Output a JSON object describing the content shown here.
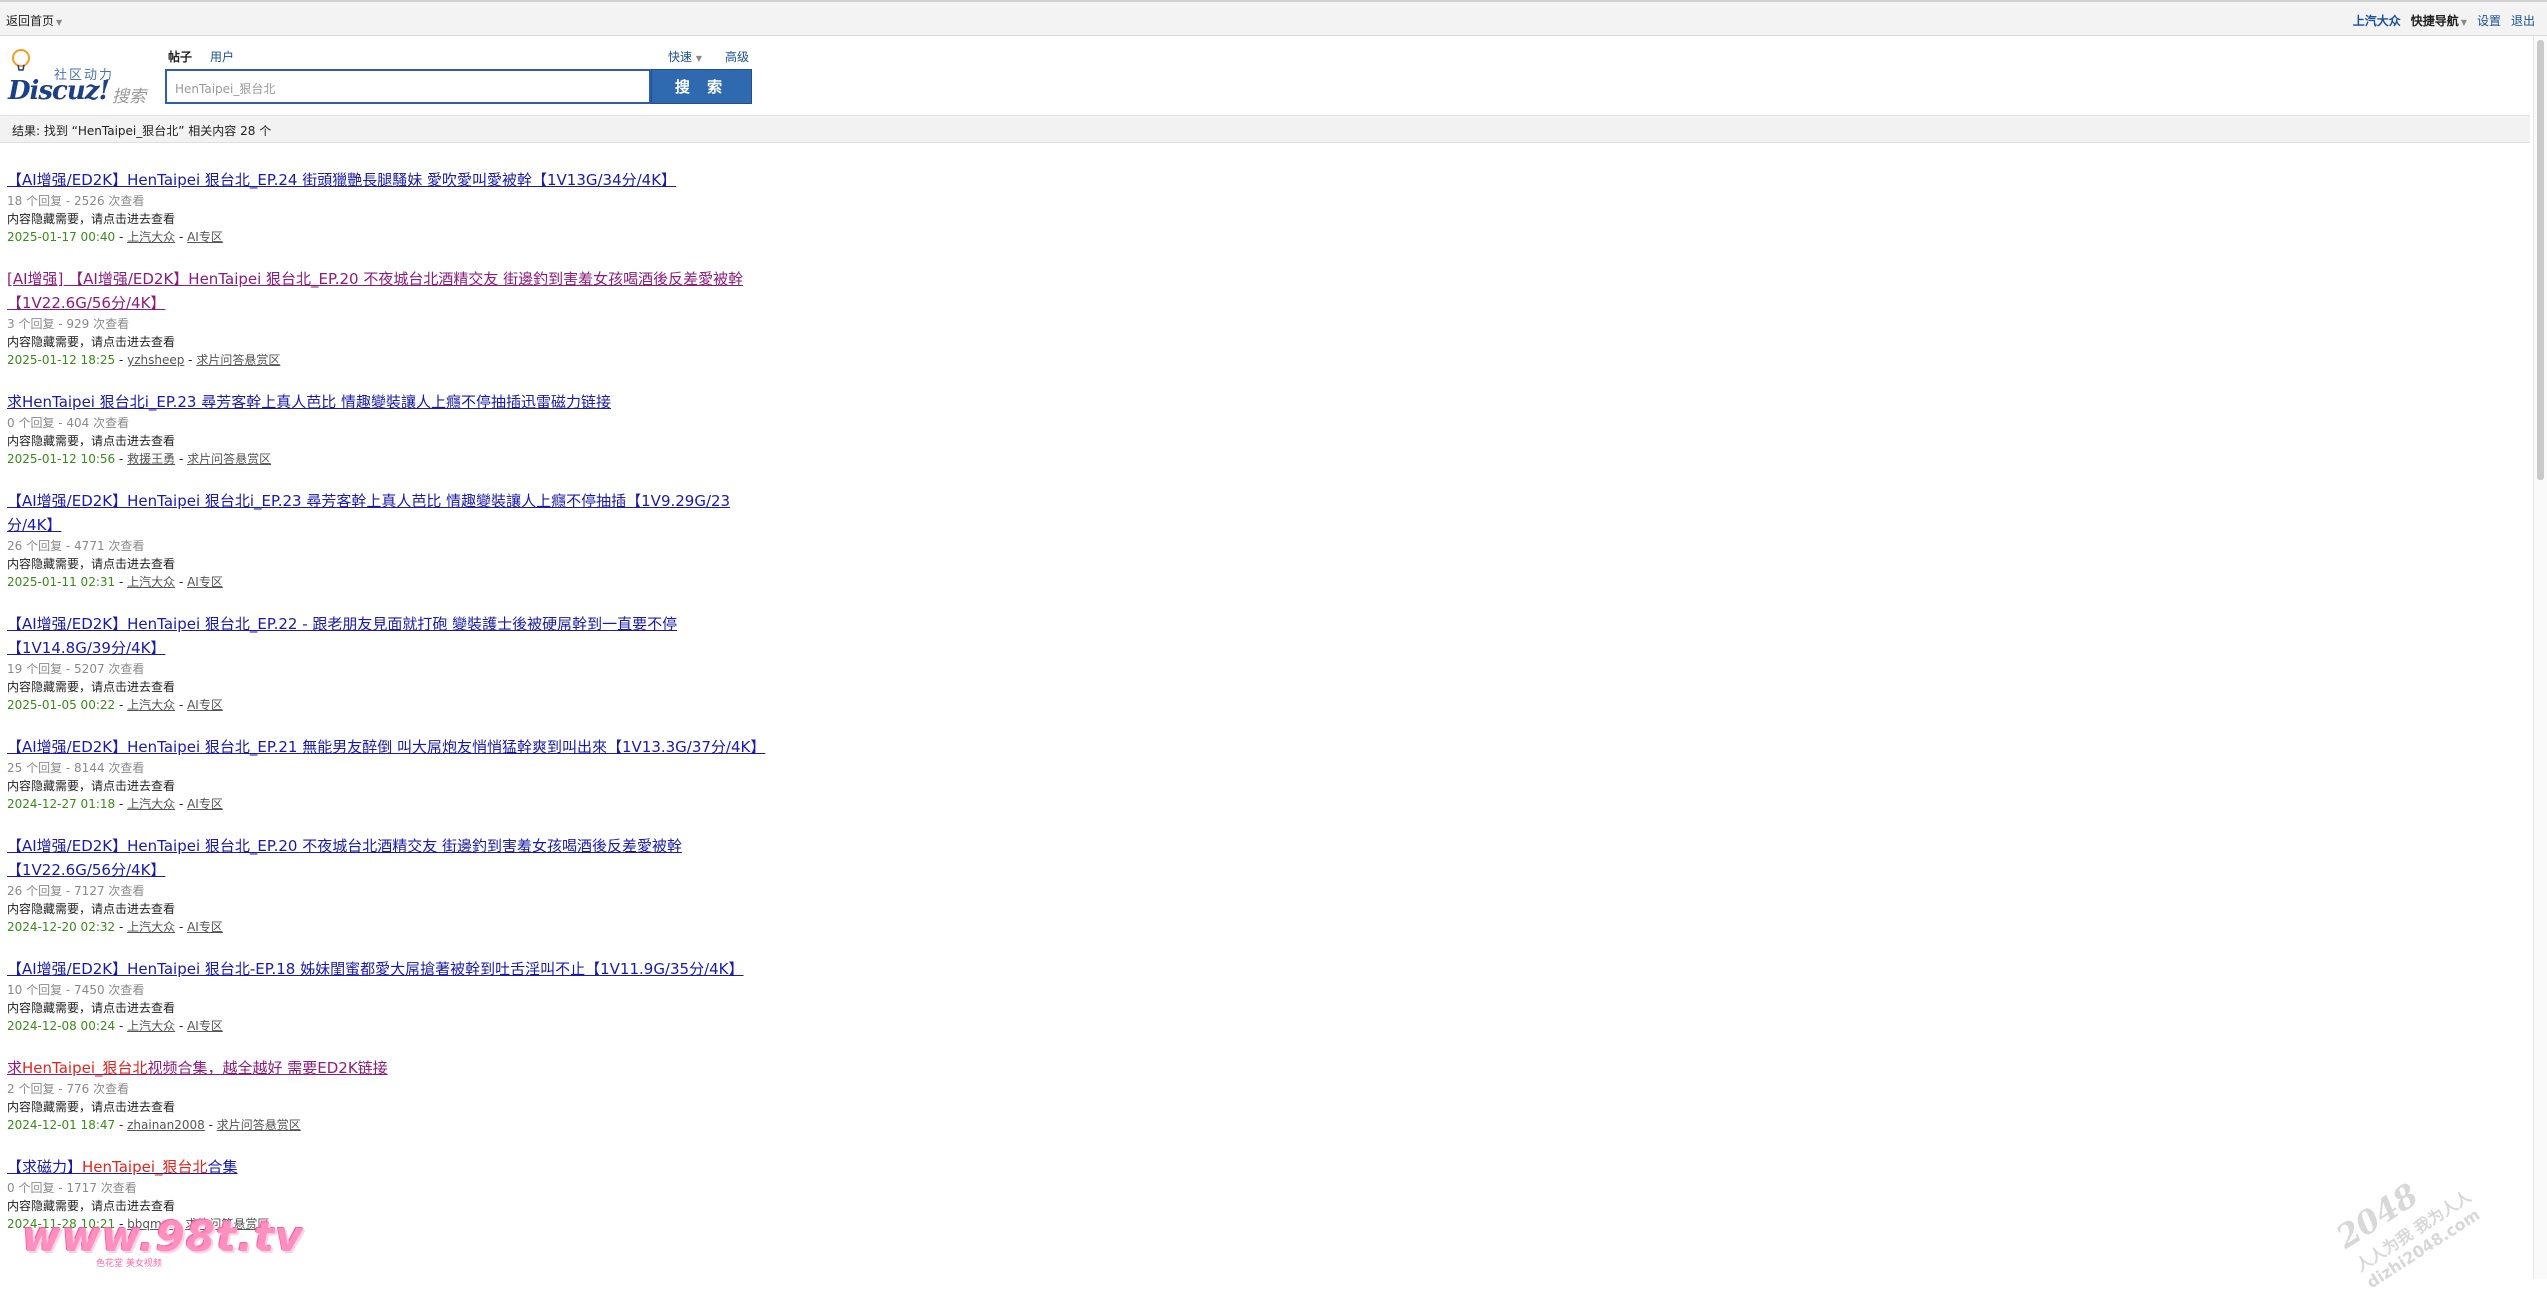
{
  "topbar": {
    "home": "返回首页",
    "user": "上汽大众",
    "quicknav": "快捷导航",
    "settings": "设置",
    "logout": "退出"
  },
  "logo": {
    "slogan": "社区动力",
    "brand": "Discuz!",
    "search_word": "搜索"
  },
  "search": {
    "types": [
      "帖子",
      "用户"
    ],
    "quick": "快速",
    "advanced": "高级",
    "query": "HenTaipei_狠台北",
    "button": "搜 索"
  },
  "result_summary": "结果: 找到 “HenTaipei_狠台北” 相关内容 28 个",
  "results": [
    {
      "title": "【AI增强/ED2K】HenTaipei 狠台北_EP.24 街頭獵艷長腿騷妹 愛吹愛叫愛被幹【1V13G/34分/4K】",
      "meta": "18 个回复 - 2526 次查看",
      "body": "内容隐藏需要，请点击进去查看",
      "date": "2025-01-17 00:40",
      "author": "上汽大众",
      "forum": "AI专区"
    },
    {
      "title": "[AI增强] 【AI增强/ED2K】HenTaipei 狠台北_EP.20 不夜城台北酒精交友 街邊釣到害羞女孩喝酒後反差愛被幹【1V22.6G/56分/4K】",
      "meta": "3 个回复 - 929 次查看",
      "body": "内容隐藏需要，请点击进去查看",
      "date": "2025-01-12 18:25",
      "author": "yzhsheep",
      "forum": "求片问答悬赏区"
    },
    {
      "title": "求HenTaipei 狠台北i_EP.23 尋芳客幹上真人芭比 情趣變裝讓人上癮不停抽插迅雷磁力链接",
      "meta": "0 个回复 - 404 次查看",
      "body": "内容隐藏需要，请点击进去查看",
      "date": "2025-01-12 10:56",
      "author": "救援王勇",
      "forum": "求片问答悬赏区"
    },
    {
      "title": "【AI增强/ED2K】HenTaipei 狠台北i_EP.23 尋芳客幹上真人芭比 情趣變裝讓人上癮不停抽插【1V9.29G/23分/4K】",
      "meta": "26 个回复 - 4771 次查看",
      "body": "内容隐藏需要，请点击进去查看",
      "date": "2025-01-11 02:31",
      "author": "上汽大众",
      "forum": "AI专区"
    },
    {
      "title": "【AI增强/ED2K】HenTaipei 狠台北_EP.22 - 跟老朋友見面就打砲 變裝護士後被硬屌幹到一直要不停【1V14.8G/39分/4K】",
      "meta": "19 个回复 - 5207 次查看",
      "body": "内容隐藏需要，请点击进去查看",
      "date": "2025-01-05 00:22",
      "author": "上汽大众",
      "forum": "AI专区"
    },
    {
      "title": "【AI增强/ED2K】HenTaipei 狠台北_EP.21 無能男友醉倒 叫大屌炮友悄悄猛幹爽到叫出來【1V13.3G/37分/4K】",
      "meta": "25 个回复 - 8144 次查看",
      "body": "内容隐藏需要，请点击进去查看",
      "date": "2024-12-27 01:18",
      "author": "上汽大众",
      "forum": "AI专区"
    },
    {
      "title": "【AI增强/ED2K】HenTaipei 狠台北_EP.20 不夜城台北酒精交友 街邊釣到害羞女孩喝酒後反差愛被幹【1V22.6G/56分/4K】",
      "meta": "26 个回复 - 7127 次查看",
      "body": "内容隐藏需要，请点击进去查看",
      "date": "2024-12-20 02:32",
      "author": "上汽大众",
      "forum": "AI专区"
    },
    {
      "title": "【AI增强/ED2K】HenTaipei 狠台北-EP.18 姊妹閨蜜都愛大屌搶著被幹到吐舌淫叫不止【1V11.9G/35分/4K】",
      "meta": "10 个回复 - 7450 次查看",
      "body": "内容隐藏需要，请点击进去查看",
      "date": "2024-12-08 00:24",
      "author": "上汽大众",
      "forum": "AI专区"
    },
    {
      "title_parts": [
        "求",
        "HenTaipei_狠台北",
        "视频合集，越全越好 需要ED2K链接"
      ],
      "meta": "2 个回复 - 776 次查看",
      "body": "内容隐藏需要，请点击进去查看",
      "date": "2024-12-01 18:47",
      "author": "zhainan2008",
      "forum": "求片问答悬赏区"
    },
    {
      "title_parts": [
        "【求磁力】",
        "HenTaipei_狠台北",
        "合集"
      ],
      "meta": "0 个回复 - 1717 次查看",
      "body": "内容隐藏需要，请点击进去查看",
      "date": "2024-11-28 10:21",
      "author": "bbqmm",
      "forum": "求片问答悬赏区"
    }
  ],
  "watermarks": {
    "site98": "www.98t.tv",
    "site98_sub": "色花堂 美女视频",
    "site2048_num": "2048",
    "site2048_slogan": "人人为我 我为人人",
    "site2048_url": "dizhi2048.com"
  }
}
